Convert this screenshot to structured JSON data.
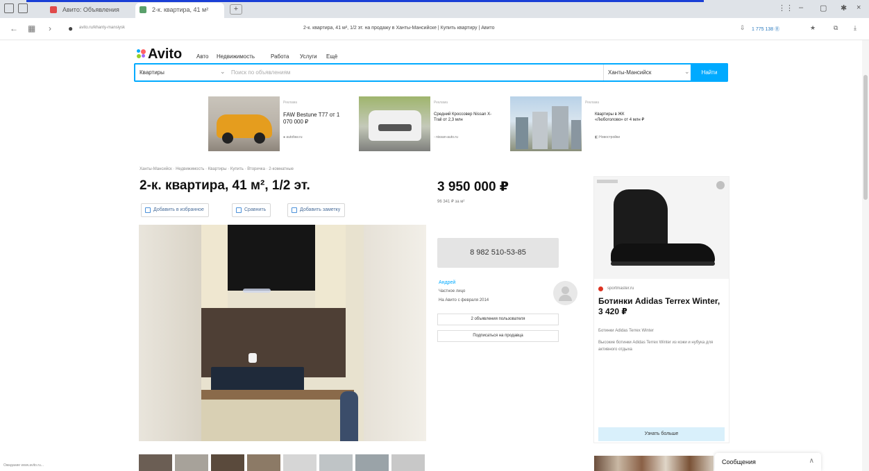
{
  "browser": {
    "tabs": [
      {
        "label": "Авито: Объявления"
      },
      {
        "label": "2-к. квартира, 41 м²"
      }
    ],
    "new_tab": "+",
    "address_url": "avito.ru/khanty-mansiysk",
    "page_title": "2-к. квартира, 41 м², 1/2 эт. на продажу в Ханты-Мансийске | Купить квартиру | Авито",
    "downloads_label": "1 775 138 Ⓡ"
  },
  "avito": {
    "logo": "Avito",
    "nav": [
      "Авто",
      "Недвижимость",
      "Работа",
      "Услуги",
      "Ещё"
    ],
    "search": {
      "category": "Квартиры",
      "placeholder": "Поиск по объявлениям",
      "city": "Ханты-Мансийск",
      "button": "Найти"
    }
  },
  "ads": [
    {
      "label": "Реклама",
      "title": "FAW Bestune T77 от 1 070 000 ₽",
      "source": "● autofaw.ru"
    },
    {
      "label": "Реклама",
      "title": "Средний Кроссовер Nissan X-Trail от 2,3 млн",
      "source": "◦ nissan-auto.ru"
    },
    {
      "label": "Реклама",
      "title": "Квартиры в ЖК «Любоголово» от 4 млн ₽",
      "source": "◧ Новостройки"
    }
  ],
  "listing": {
    "breadcrumbs": "Ханты-Мансийск · Недвижимость · Квартиры · Купить · Вторичка · 2-комнатные",
    "title": "2-к. квартира, 41 м², 1/2 эт.",
    "actions": [
      "Добавить в избранное",
      "Сравнить",
      "Добавить заметку"
    ],
    "price": "3 950 000 ₽",
    "price_per_m2": "96 341 ₽ за м²",
    "phone": "8 982 510-53-85",
    "seller": {
      "name": "Андрей",
      "type": "Частное лицо",
      "since": "На Авито с февраля 2014"
    },
    "seller_buttons": [
      "2 объявления пользователя",
      "Подписаться на продавца"
    ]
  },
  "right_ad": {
    "brand": "sportmaster.ru",
    "title": "Ботинки Adidas Terrex Winter, 3 420 ₽",
    "subtitle": "Ботинки Adidas Terrex Winter",
    "description": "Высокие ботинки Adidas Terrex Winter из кожи и нубука для активного отдыха",
    "more": "Узнать больше"
  },
  "messages": {
    "label": "Сообщения",
    "toggle": "∧"
  },
  "status_bar": "Ожидание www.avito.ru..."
}
